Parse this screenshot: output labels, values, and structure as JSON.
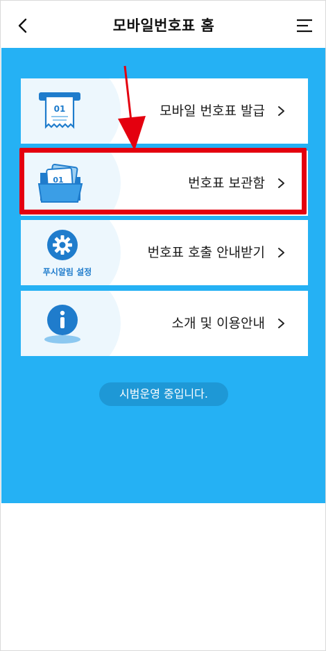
{
  "header": {
    "title": "모바일번호표 홈",
    "back_icon": "chevron-left-icon",
    "menu_icon": "hamburger-menu-icon"
  },
  "menu_items": [
    {
      "label": "모바일 번호표 발급",
      "icon": "ticket-issue-icon",
      "ticket_number": "01"
    },
    {
      "label": "번호표 보관함",
      "icon": "folder-tickets-icon",
      "ticket_number": "01"
    },
    {
      "label": "번호표 호출 안내받기",
      "icon": "gear-icon",
      "sub_label": "푸시알림 설정"
    },
    {
      "label": "소개 및 이용안내",
      "icon": "info-icon"
    }
  ],
  "status": {
    "text": "시범운영 중입니다."
  },
  "colors": {
    "main_background": "#25b1f4",
    "highlight_border": "#e4000f",
    "status_pill": "#1e98d6",
    "icon_blue": "#1f7ccc"
  }
}
